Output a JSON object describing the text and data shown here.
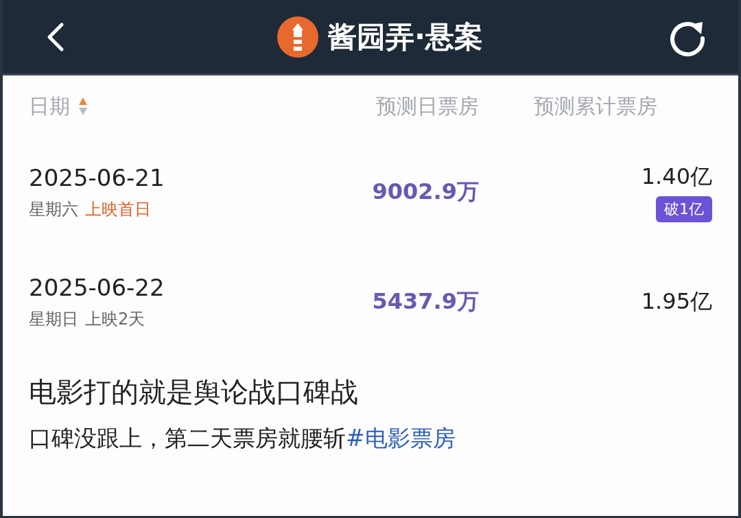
{
  "header": {
    "title": "酱园弄·悬案"
  },
  "table": {
    "columns": [
      "日期",
      "预测日票房",
      "预测累计票房"
    ],
    "rows": [
      {
        "date": "2025-06-21",
        "weekday": "星期六",
        "status": "上映首日",
        "highlight": true,
        "daily": "9002.9万",
        "total": "1.40亿",
        "badge": "破1亿"
      },
      {
        "date": "2025-06-22",
        "weekday": "星期日",
        "status": "上映2天",
        "highlight": false,
        "daily": "5437.9万",
        "total": "1.95亿"
      }
    ]
  },
  "post": {
    "title": "电影打的就是舆论战口碑战",
    "text": "口碑没跟上，第二天票房就腰斩",
    "tag": "#电影票房"
  }
}
